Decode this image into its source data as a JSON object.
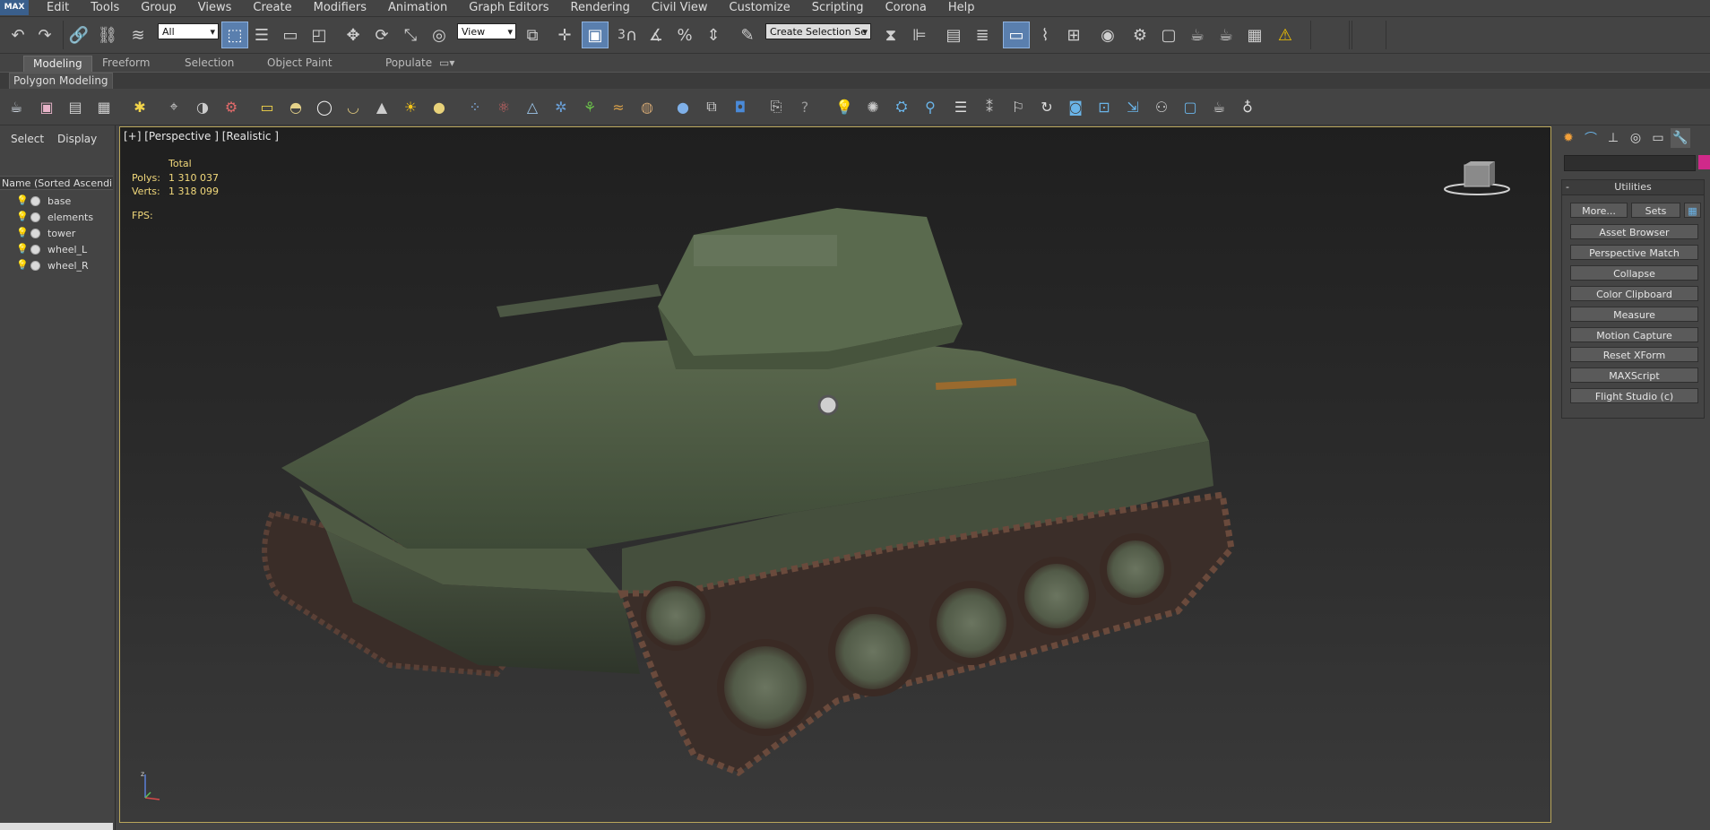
{
  "menu": {
    "logo": "MAX",
    "items": [
      "Edit",
      "Tools",
      "Group",
      "Views",
      "Create",
      "Modifiers",
      "Animation",
      "Graph Editors",
      "Rendering",
      "Civil View",
      "Customize",
      "Scripting",
      "Corona",
      "Help"
    ]
  },
  "toolbar": {
    "selection_filter": "All",
    "reference_coord": "View",
    "snaps_label": "3",
    "named_selection_placeholder": "Create Selection Se"
  },
  "ribbon": {
    "tabs": [
      "Modeling",
      "Freeform",
      "Selection",
      "Object Paint",
      "Populate"
    ],
    "panel_label": "Polygon Modeling"
  },
  "explorer": {
    "tabs": [
      "Select",
      "Display"
    ],
    "header": "Name (Sorted Ascending)",
    "objects": [
      "base",
      "elements",
      "tower",
      "wheel_L",
      "wheel_R"
    ]
  },
  "viewport": {
    "label": "[+] [Perspective ] [Realistic ]",
    "stats": {
      "total_label": "Total",
      "polys_label": "Polys:",
      "polys_value": "1 310 037",
      "verts_label": "Verts:",
      "verts_value": "1 318 099",
      "fps_label": "FPS:"
    },
    "axis_label": "z"
  },
  "command_panel": {
    "rollout_title": "Utilities",
    "more_label": "More...",
    "sets_label": "Sets",
    "buttons": [
      "Asset Browser",
      "Perspective Match",
      "Collapse",
      "Color Clipboard",
      "Measure",
      "Motion Capture",
      "Reset XForm",
      "MAXScript",
      "Flight Studio (c)"
    ]
  },
  "colors": {
    "ui_background": "#444444",
    "viewport_border": "#b9a65b",
    "stats_text": "#f2d97b",
    "active_button": "#5a7fae",
    "color_swatch": "#d0298a"
  }
}
